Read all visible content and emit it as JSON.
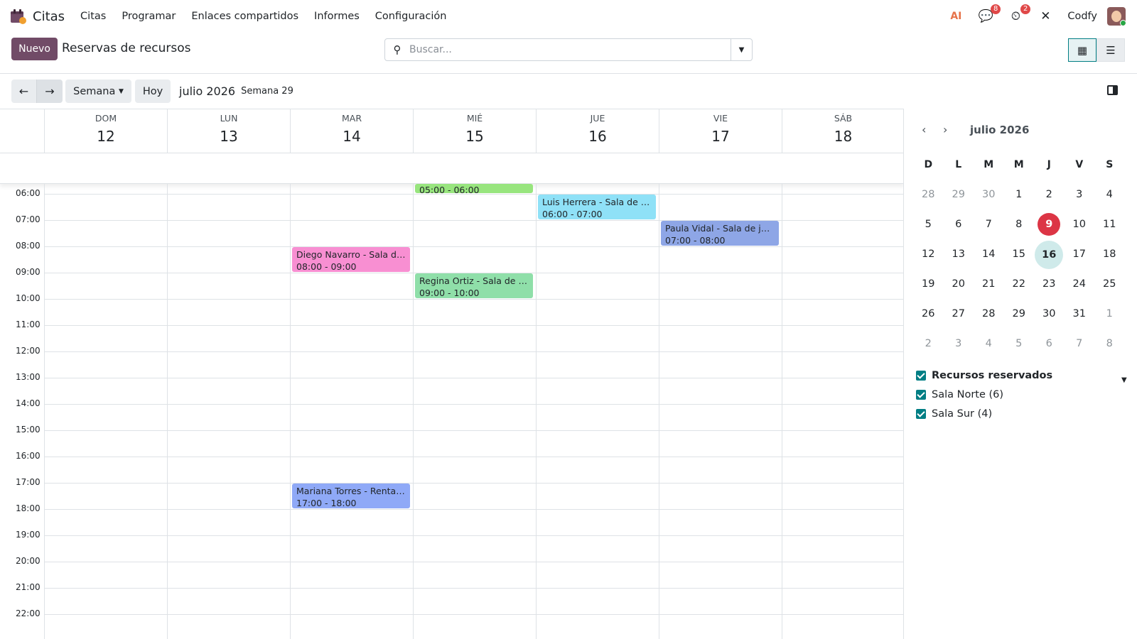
{
  "app": {
    "name": "Citas"
  },
  "menu": [
    "Citas",
    "Programar",
    "Enlaces compartidos",
    "Informes",
    "Configuración"
  ],
  "nav": {
    "ai_label": "AI",
    "messages_badge": "8",
    "activities_badge": "2",
    "company": "Codfy"
  },
  "control": {
    "new_label": "Nuevo",
    "breadcrumb": "Reservas de recursos",
    "search_placeholder": "Buscar..."
  },
  "toolbar": {
    "prev": "←",
    "next": "→",
    "scale": "Semana",
    "today": "Hoy",
    "period": "julio 2026",
    "week": "Semana 29"
  },
  "days": [
    {
      "name": "DOM",
      "num": "12"
    },
    {
      "name": "LUN",
      "num": "13"
    },
    {
      "name": "MAR",
      "num": "14"
    },
    {
      "name": "MIÉ",
      "num": "15"
    },
    {
      "name": "JUE",
      "num": "16"
    },
    {
      "name": "VIE",
      "num": "17"
    },
    {
      "name": "SÁB",
      "num": "18"
    }
  ],
  "hours": [
    "06:00",
    "07:00",
    "08:00",
    "09:00",
    "10:00",
    "11:00",
    "12:00",
    "13:00",
    "14:00",
    "15:00",
    "16:00",
    "17:00",
    "18:00",
    "19:00",
    "20:00",
    "21:00",
    "22:00"
  ],
  "events": [
    {
      "title": "",
      "time": "05:00 - 06:00",
      "day": 3,
      "start": 5,
      "end": 6,
      "color": "#98e57e"
    },
    {
      "title": "Luis Herrera - Sala de j...",
      "time": "06:00 - 07:00",
      "day": 4,
      "start": 6,
      "end": 7,
      "color": "#8fe1f7"
    },
    {
      "title": "Paula Vidal - Sala de ju...",
      "time": "07:00 - 08:00",
      "day": 5,
      "start": 7,
      "end": 8,
      "color": "#8ea6e6"
    },
    {
      "title": "Diego Navarro - Sala de...",
      "time": "08:00 - 09:00",
      "day": 2,
      "start": 8,
      "end": 9,
      "color": "#f88fd2"
    },
    {
      "title": "Regina Ortiz - Sala de j...",
      "time": "09:00 - 10:00",
      "day": 3,
      "start": 9,
      "end": 10,
      "color": "#8fdfa9"
    },
    {
      "title": "Mariana Torres - Renta ...",
      "time": "17:00 - 18:00",
      "day": 2,
      "start": 17,
      "end": 18,
      "color": "#8fa9f7"
    }
  ],
  "mini": {
    "title": "julio 2026",
    "headers": [
      "D",
      "L",
      "M",
      "M",
      "J",
      "V",
      "S"
    ],
    "weeks": [
      [
        {
          "d": "28",
          "out": true
        },
        {
          "d": "29",
          "out": true
        },
        {
          "d": "30",
          "out": true
        },
        {
          "d": "1"
        },
        {
          "d": "2"
        },
        {
          "d": "3"
        },
        {
          "d": "4"
        }
      ],
      [
        {
          "d": "5"
        },
        {
          "d": "6"
        },
        {
          "d": "7"
        },
        {
          "d": "8"
        },
        {
          "d": "9",
          "today": true
        },
        {
          "d": "10"
        },
        {
          "d": "11"
        }
      ],
      [
        {
          "d": "12"
        },
        {
          "d": "13"
        },
        {
          "d": "14"
        },
        {
          "d": "15"
        },
        {
          "d": "16",
          "sel": true
        },
        {
          "d": "17"
        },
        {
          "d": "18"
        }
      ],
      [
        {
          "d": "19"
        },
        {
          "d": "20"
        },
        {
          "d": "21"
        },
        {
          "d": "22"
        },
        {
          "d": "23"
        },
        {
          "d": "24"
        },
        {
          "d": "25"
        }
      ],
      [
        {
          "d": "26"
        },
        {
          "d": "27"
        },
        {
          "d": "28"
        },
        {
          "d": "29"
        },
        {
          "d": "30"
        },
        {
          "d": "31"
        },
        {
          "d": "1",
          "out": true
        }
      ],
      [
        {
          "d": "2",
          "out": true
        },
        {
          "d": "3",
          "out": true
        },
        {
          "d": "4",
          "out": true
        },
        {
          "d": "5",
          "out": true
        },
        {
          "d": "6",
          "out": true
        },
        {
          "d": "7",
          "out": true
        },
        {
          "d": "8",
          "out": true
        }
      ]
    ]
  },
  "filters": {
    "title": "Recursos reservados",
    "items": [
      "Sala Norte (6)",
      "Sala Sur (4)"
    ]
  },
  "colors": {
    "brand": "#714b67",
    "accent": "#017e84",
    "today": "#dc3545"
  }
}
